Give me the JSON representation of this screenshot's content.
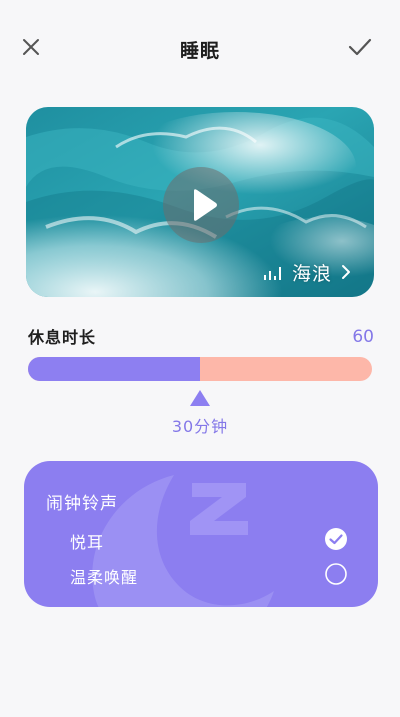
{
  "header": {
    "title": "睡眠",
    "close_icon": "close-icon",
    "confirm_icon": "check-icon"
  },
  "sound": {
    "name": "海浪",
    "play_icon": "play-icon",
    "bars_icon": "sound-bars-icon",
    "chevron_icon": "chevron-right-icon"
  },
  "duration": {
    "label": "休息时长",
    "max": "60",
    "value_text": "30分钟",
    "value_fraction": 0.5
  },
  "alarm": {
    "title": "闹钟铃声",
    "options": [
      {
        "label": "悦耳",
        "selected": true
      },
      {
        "label": "温柔唤醒",
        "selected": false
      }
    ]
  },
  "colors": {
    "accent": "#8d7ff1",
    "slider_rest": "#fdb7a9",
    "alarm_card": "#8c7ef0"
  }
}
